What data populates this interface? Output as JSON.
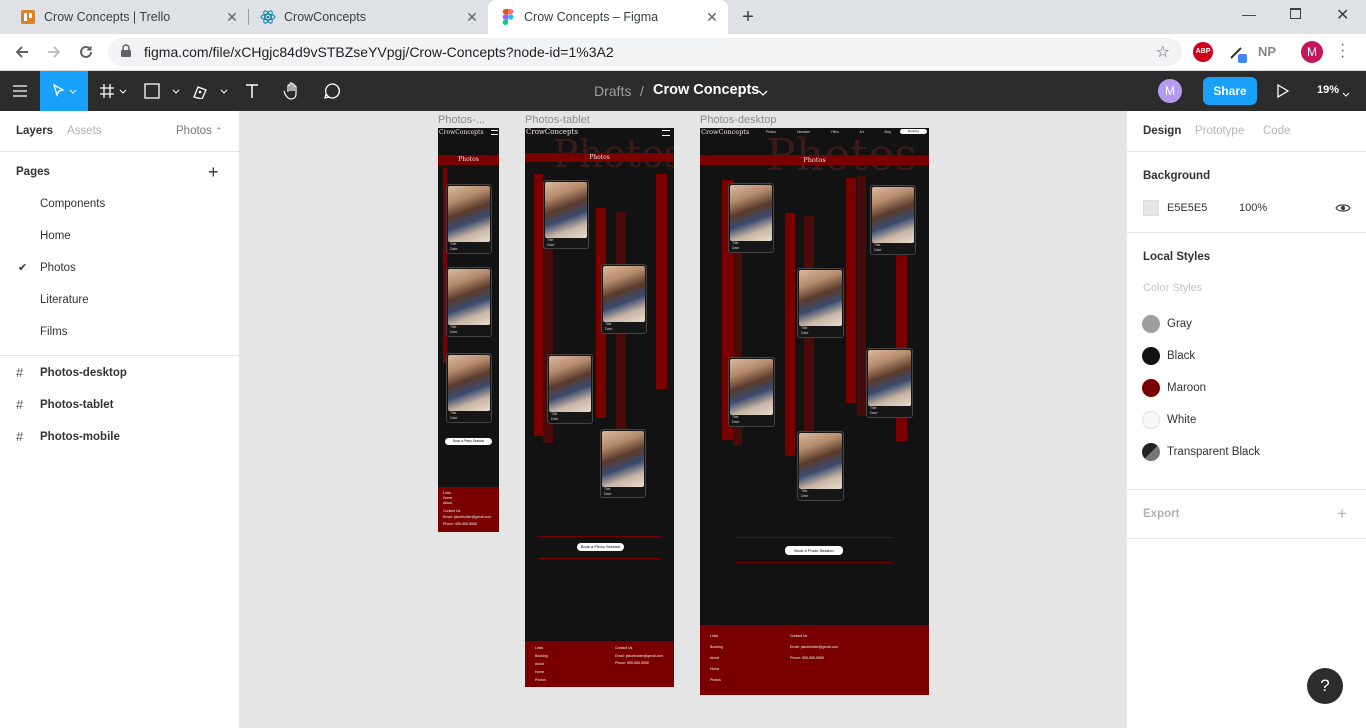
{
  "browser": {
    "tabs": [
      {
        "title": "Crow Concepts | Trello",
        "icon": "trello-icon"
      },
      {
        "title": "CrowConcepts",
        "icon": "react-icon"
      },
      {
        "title": "Crow Concepts – Figma",
        "icon": "figma-icon"
      }
    ],
    "url": "figma.com/file/xCHgjc84d9vSTBZseYVpgj/Crow-Concepts?node-id=1%3A2",
    "extensions": [
      "ABP",
      "NP"
    ],
    "profile_initial": "M"
  },
  "toolbar": {
    "breadcrumb_parent": "Drafts",
    "breadcrumb_sep": "/",
    "file_name": "Crow Concepts",
    "avatar_initial": "M",
    "share_label": "Share",
    "zoom": "19%"
  },
  "left": {
    "tab_layers": "Layers",
    "tab_assets": "Assets",
    "current_page": "Photos",
    "pages_title": "Pages",
    "pages": [
      "Components",
      "Home",
      "Photos",
      "Literature",
      "Films"
    ],
    "frames": [
      "Photos-desktop",
      "Photos-tablet",
      "Photos-mobile"
    ]
  },
  "right": {
    "tab_design": "Design",
    "tab_prototype": "Prototype",
    "tab_code": "Code",
    "background_title": "Background",
    "background_hex": "E5E5E5",
    "background_opacity": "100%",
    "local_styles_title": "Local Styles",
    "color_styles_title": "Color Styles",
    "styles": [
      {
        "name": "Gray",
        "color": "#9e9e9e"
      },
      {
        "name": "Black",
        "color": "#121212"
      },
      {
        "name": "Maroon",
        "color": "#7a0000"
      },
      {
        "name": "White",
        "color": "#f7f7f7"
      },
      {
        "name": "Transparent Black",
        "color": "#3a3a3a"
      }
    ],
    "export_title": "Export"
  },
  "canvas": {
    "frame_labels": {
      "mobile": "Photos-...",
      "tablet": "Photos-tablet",
      "desktop": "Photos-desktop"
    },
    "site": {
      "brand": "CrowConcepts",
      "brand_mobile": "CrowConcepts",
      "heading": "Photos",
      "card_title": "Title",
      "card_date": "Date",
      "cta": "Book a Photo Session",
      "nav": [
        "Photos",
        "Literature",
        "Films",
        "Art",
        "Blog",
        "Booking"
      ],
      "footer_links_title": "Links",
      "footer_contact_title": "Contact Us",
      "footer_links": [
        "Booking",
        "About",
        "Home",
        "Photos"
      ],
      "footer_email": "Email: placeholder@gmail.com",
      "footer_phone": "Phone: 555-555-5555"
    }
  },
  "help": "?"
}
